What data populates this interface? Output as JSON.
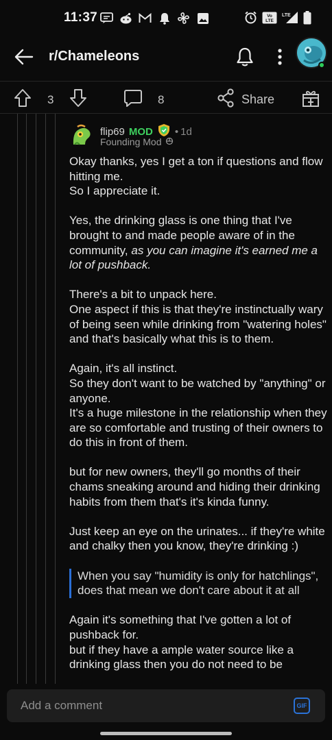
{
  "status_bar": {
    "time": "11:37",
    "lte_label": "LTE",
    "volte_label": "VoLTE"
  },
  "header": {
    "title": "r/Chameleons"
  },
  "post_actions": {
    "upvotes": "3",
    "comments": "8",
    "share_label": "Share"
  },
  "comment": {
    "author": "flip69",
    "mod_badge": "MOD",
    "separator": "•",
    "time": "1d",
    "flair": "Founding Mod",
    "paragraphs": [
      [
        "Okay thanks, yes I get a ton if questions and flow hitting me.",
        "So I appreciate it."
      ],
      [
        "Yes, the drinking glass is one thing that I've brought to and made people aware of in the community,"
      ],
      [
        "There's a bit to unpack here.",
        "One aspect if this is that they're instinctually wary of being seen while drinking from \"watering holes\" and that's basically what this is to them."
      ],
      [
        "Again, it's all instinct.",
        "So they don't want to be watched by \"anything\" or anyone.",
        "It's a huge milestone in the relationship when they are so comfortable and trusting of their owners to do this in front of them."
      ],
      [
        "but for new owners, they'll go months of their chams sneaking around and hiding their drinking habits from them that's it's kinda funny."
      ],
      [
        "Just keep an eye on the urinates... if they're white and chalky then you know, they're drinking :)"
      ],
      [
        "Again it's something that I've gotten a lot of pushback for.",
        "but if they have a ample water source like a drinking glass then you do not need to be"
      ]
    ],
    "italic_part": "as you can imagine it's earned me a lot of pushback.",
    "quote": "When you say \"humidity is only for hatchlings\", does that mean we don't care about it at all"
  },
  "composer": {
    "placeholder": "Add a comment",
    "gif_label": "GIF"
  },
  "colors": {
    "background": "#0b0b0b",
    "mod_green": "#3ecf5e",
    "quote_blue": "#2a6fd6",
    "avatar_teal": "#49b8cc"
  }
}
